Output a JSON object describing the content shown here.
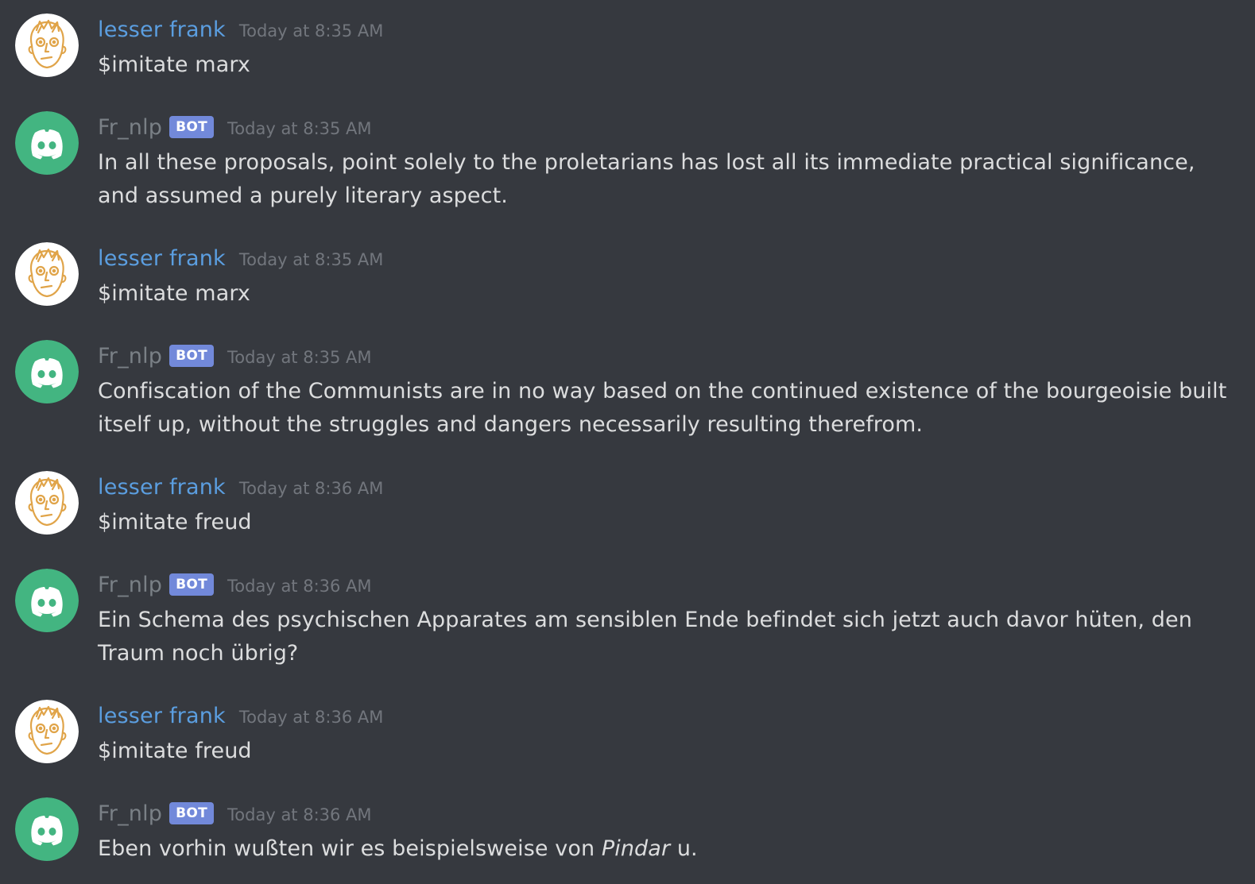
{
  "colors": {
    "background": "#36393f",
    "user_name": "#5b9ee0",
    "bot_name": "#7a8086",
    "bot_badge": "#7289da",
    "timestamp": "#72767d",
    "message_text": "#dcddde",
    "bot_avatar_bg": "#43b581",
    "user_avatar_bg": "#ffffff",
    "user_avatar_lines": "#e0a449"
  },
  "bot_badge_label": "BOT",
  "messages": [
    {
      "author": "lesser frank",
      "author_type": "user",
      "avatar_icon": "user-avatar-sketch-face-icon",
      "timestamp": "Today at 8:35 AM",
      "text": "$imitate marx"
    },
    {
      "author": "Fr_nlp",
      "author_type": "bot",
      "avatar_icon": "discord-logo-icon",
      "timestamp": "Today at 8:35 AM",
      "text": "In all these proposals, point solely to the proletarians has lost all its immediate practical significance, and assumed a purely literary aspect."
    },
    {
      "author": "lesser frank",
      "author_type": "user",
      "avatar_icon": "user-avatar-sketch-face-icon",
      "timestamp": "Today at 8:35 AM",
      "text": "$imitate marx"
    },
    {
      "author": "Fr_nlp",
      "author_type": "bot",
      "avatar_icon": "discord-logo-icon",
      "timestamp": "Today at 8:35 AM",
      "text": "Confiscation of the Communists are in no way based on the continued existence of the bourgeoisie built itself up, without the struggles and dangers necessarily resulting therefrom."
    },
    {
      "author": "lesser frank",
      "author_type": "user",
      "avatar_icon": "user-avatar-sketch-face-icon",
      "timestamp": "Today at 8:36 AM",
      "text": "$imitate freud"
    },
    {
      "author": "Fr_nlp",
      "author_type": "bot",
      "avatar_icon": "discord-logo-icon",
      "timestamp": "Today at 8:36 AM",
      "text": "Ein Schema des psychischen Apparates am sensiblen Ende befindet sich jetzt auch davor hüten, den Traum noch übrig?"
    },
    {
      "author": "lesser frank",
      "author_type": "user",
      "avatar_icon": "user-avatar-sketch-face-icon",
      "timestamp": "Today at 8:36 AM",
      "text": "$imitate freud"
    },
    {
      "author": "Fr_nlp",
      "author_type": "bot",
      "avatar_icon": "discord-logo-icon",
      "timestamp": "Today at 8:36 AM",
      "text_before": "Eben vorhin wußten wir es beispielsweise von ",
      "text_italic": "Pindar",
      "text_after": " u."
    }
  ]
}
